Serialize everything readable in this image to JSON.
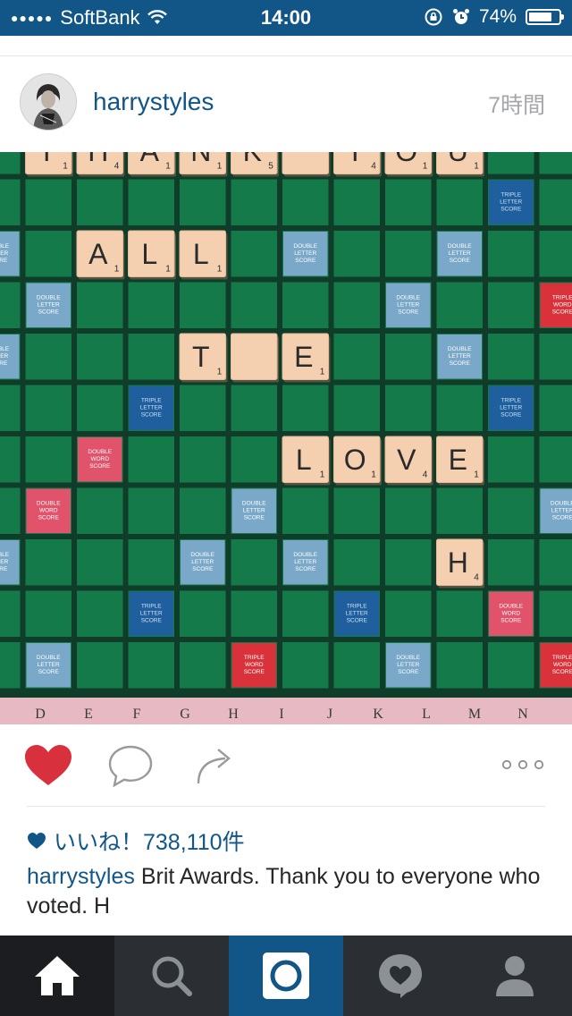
{
  "status_bar": {
    "carrier": "SoftBank",
    "time": "14:00",
    "battery": "74%",
    "battery_level": 0.74
  },
  "post": {
    "username": "harrystyles",
    "time_ago": "7時間",
    "likes": "いいね！738,110件",
    "caption_user": "harrystyles",
    "caption_text": " Brit Awards. Thank you to everyone who voted. H"
  },
  "board": {
    "words": [
      {
        "letters": [
          "T",
          "H",
          "A",
          "N",
          "K",
          " ",
          "Y",
          "O",
          "U"
        ],
        "scores": [
          "1",
          "4",
          "1",
          "1",
          "5",
          "",
          "4",
          "1",
          "1"
        ]
      },
      {
        "letters": [
          "A",
          "L",
          "L"
        ],
        "scores": [
          "1",
          "1",
          "1"
        ]
      },
      {
        "letters": [
          "T",
          " ",
          "E"
        ],
        "scores": [
          "1",
          "",
          "1"
        ]
      },
      {
        "letters": [
          "L",
          "O",
          "V",
          "E"
        ],
        "scores": [
          "1",
          "1",
          "4",
          "1"
        ]
      },
      {
        "letters": [
          "H"
        ],
        "scores": [
          "4"
        ]
      }
    ],
    "premium_labels": {
      "dl": "DOUBLE LETTER SCORE",
      "tl": "TRIPLE LETTER SCORE",
      "dw": "DOUBLE WORD SCORE",
      "tw": "TRIPLE WORD SCORE"
    },
    "column_letters": [
      "D",
      "E",
      "F",
      "G",
      "H",
      "I",
      "J",
      "K",
      "L",
      "M",
      "N"
    ]
  },
  "icons": {
    "home": "home-icon",
    "search": "search-icon",
    "camera": "camera-icon",
    "activity": "activity-heart-icon",
    "profile": "profile-icon",
    "like": "heart-icon",
    "comment": "comment-icon",
    "share": "share-icon",
    "more": "more-icon"
  },
  "colors": {
    "brand": "#125688",
    "like_red": "#d8303c",
    "board_green": "#147a4a",
    "tile": "#f4cfb0"
  }
}
